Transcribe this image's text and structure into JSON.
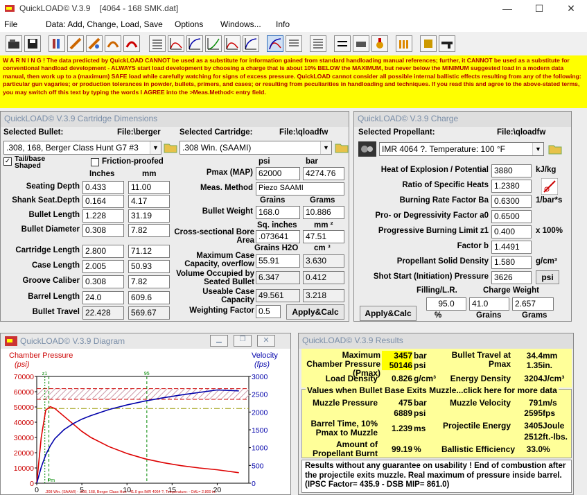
{
  "window": {
    "title": "QuickLOAD© V.3.9    [4064 - 168 SMK.dat]",
    "minimize": "—",
    "maximize": "☐",
    "close": "✕"
  },
  "menu": {
    "file": "File",
    "data": "Data: Add, Change, Load, Save",
    "options": "Options",
    "windows": "Windows...",
    "info": "Info"
  },
  "warning": "W A R N I N G ! The data predicted by QuickLOAD CANNOT be used as a substitute for information gained from standard handloading manual references; further, it CANNOT be used as a substitute for conventional handload development - ALWAYS start load development by choosing a charge that is about 10% BELOW the MAXIMUM, but never below the MINIMUM suggested load in a modern data manual, then work up to a (maximum) SAFE load while carefully watching for signs of excess pressure. QuickLOAD cannot consider all possible internal ballistic effects resulting from any of the following: particular gun vagaries; or production tolerances in powder, bullets, primers, and cases; or resulting from peculiarities in handloading and techniques. If you read this and agree to the above-stated terms, you may switch off this text by typing the words I AGREE into the >Meas.Method< entry field.",
  "cart": {
    "title": "QuickLOAD© V.3.9 Cartridge Dimensions",
    "selected_bullet_label": "Selected Bullet:",
    "bullet_file": "File:\\berger",
    "bullet": ".308, 168, Berger Class Hunt G7 #3",
    "selected_cart_label": "Selected Cartridge:",
    "cart_file": "File:\\qloadfw",
    "cartridge": ".308 Win. (SAAMI)",
    "tail_base": "Tail/base Shaped",
    "friction": "Friction-proofed",
    "inches": "Inches",
    "mm": "mm",
    "rows": [
      {
        "label": "Seating Depth",
        "in": "0.433",
        "mm": "11.00"
      },
      {
        "label": "Shank Seat.Depth",
        "in": "0.164",
        "mm": "4.17"
      },
      {
        "label": "Bullet Length",
        "in": "1.228",
        "mm": "31.19"
      },
      {
        "label": "Bullet Diameter",
        "in": "0.308",
        "mm": "7.82"
      },
      {
        "label": "Cartridge Length",
        "in": "2.800",
        "mm": "71.12"
      },
      {
        "label": "Case Length",
        "in": "2.005",
        "mm": "50.93"
      },
      {
        "label": "Groove Caliber",
        "in": "0.308",
        "mm": "7.82"
      },
      {
        "label": "Barrel Length",
        "in": "24.0",
        "mm": "609.6"
      },
      {
        "label": "Bullet Travel",
        "in": "22.428",
        "mm": "569.67"
      }
    ],
    "psi": "psi",
    "bar": "bar",
    "pmax_label": "Pmax (MAP)",
    "pmax_psi": "62000",
    "pmax_bar": "4274.76",
    "meas_label": "Meas. Method",
    "meas": "Piezo SAAMI",
    "grains": "Grains",
    "grams": "Grams",
    "bw_label": "Bullet Weight",
    "bw_gr": "168.0",
    "bw_g": "10.886",
    "sq_in": "Sq. inches",
    "mm2": "mm ²",
    "csba_label": "Cross-sectional Bore Area",
    "csba_in": ".073641",
    "csba_mm": "47.51",
    "grains_h2o": "Grains H2O",
    "cm3": "cm ³",
    "mcc_label": "Maximum Case Capacity, overflow",
    "mcc_gr": "55.91",
    "mcc_cm": "3.630",
    "vol_label": "Volume Occupied by Seated Bullet",
    "vol_gr": "6.347",
    "vol_cm": "0.412",
    "ucc_label": "Useable Case Capacity",
    "ucc_gr": "49.561",
    "ucc_cm": "3.218",
    "wf_label": "Weighting Factor",
    "wf": "0.5",
    "apply": "Apply&Calc"
  },
  "charge": {
    "title": "QuickLOAD© V.3.9 Charge",
    "selected_label": "Selected Propellant:",
    "file": "File:\\qloadfw",
    "propellant": "IMR 4064 ?.  Temperature: 100 °F",
    "rows": [
      {
        "label": "Heat of Explosion / Potential",
        "value": "3880",
        "unit": "kJ/kg"
      },
      {
        "label": "Ratio of Specific Heats",
        "value": "1.2380",
        "unit": ""
      },
      {
        "label": "Burning Rate Factor  Ba",
        "value": "0.6300",
        "unit": "1/bar*s"
      },
      {
        "label": "Pro- or Degressivity Factor  a0",
        "value": "0.6500",
        "unit": ""
      },
      {
        "label": "Progressive Burning Limit z1",
        "value": "0.400",
        "unit": "x 100%"
      },
      {
        "label": "Factor  b",
        "value": "1.4491",
        "unit": ""
      },
      {
        "label": "Propellant Solid Density",
        "value": "1.580",
        "unit": "g/cm³"
      },
      {
        "label": "Shot Start (Initiation) Pressure",
        "value": "3626",
        "unit": "psi"
      }
    ],
    "filling_label": "Filling/L.R.",
    "charge_weight": "Charge Weight",
    "filling": "95.0",
    "cw_gr": "41.0",
    "cw_g": "2.657",
    "pct": "%",
    "grains": "Grains",
    "grams": "Grams",
    "apply": "Apply&Calc"
  },
  "diagram": {
    "title": "QuickLOAD© V.3.9 Diagram",
    "left_axis_title": "Chamber Pressure",
    "left_unit": "(psi)",
    "right_axis_title": "Velocity",
    "right_unit": "(fps)",
    "xlabel": "Projectile travel (in.)",
    "y_ticks": [
      "70000",
      "60000",
      "50000",
      "40000",
      "30000",
      "20000",
      "10000",
      "0"
    ],
    "v_ticks": [
      "3000",
      "2500",
      "2000",
      "1500",
      "1000",
      "500",
      "0"
    ],
    "x_ticks": [
      "0",
      "5",
      "10",
      "15",
      "20"
    ],
    "mark_z1": "z1",
    "mark_95": "95",
    "mark_pm": "Pm",
    "footer": ".308 Win. (SAAMI) - .308, 168, Berger Class Hun - 41.0 grs IMR 4064 ?, Temperature: - OAL= 2.800 in."
  },
  "chart_data": {
    "type": "line",
    "xlabel": "Projectile travel (in.)",
    "ylabel": "Chamber Pressure (psi)",
    "y2label": "Velocity (fps)",
    "xlim": [
      0,
      23.5
    ],
    "ylim": [
      0,
      70000
    ],
    "y2lim": [
      0,
      3000
    ],
    "series": [
      {
        "axis": "left",
        "x": [
          0,
          0.5,
          1,
          1.5,
          2,
          3,
          4,
          5,
          6,
          8,
          10,
          12,
          14,
          16,
          18,
          20,
          22.4
        ],
        "values": [
          0,
          30000,
          48000,
          50146,
          49000,
          44000,
          39000,
          34000,
          30000,
          24000,
          19500,
          16000,
          13500,
          11500,
          10000,
          8800,
          6889
        ]
      },
      {
        "axis": "right",
        "x": [
          0,
          0.5,
          1,
          1.5,
          2,
          3,
          4,
          5,
          6,
          8,
          10,
          12,
          14,
          16,
          18,
          20,
          22.4
        ],
        "values": [
          0,
          450,
          800,
          1050,
          1250,
          1500,
          1670,
          1800,
          1900,
          2070,
          2200,
          2310,
          2400,
          2480,
          2550,
          2620,
          2595
        ]
      }
    ]
  },
  "results": {
    "title": "QuickLOAD© V.3.9 Results",
    "mcp_label": "Maximum Chamber Pressure (Pmax)",
    "mcp_bar": "3457",
    "bar": "bar",
    "mcp_psi": "50146",
    "psi": "psi",
    "btp_label": "Bullet Travel at Pmax",
    "btp_mm": "34.4",
    "mm": "mm",
    "btp_in": "1.35",
    "in": "in.",
    "ld_label": "Load Density",
    "ld": "0.826",
    "gcm3": "g/cm³",
    "en_label": "Energy Density",
    "en": "3204",
    "jcm3": "J/cm³",
    "exit_header": "Values when Bullet Base Exits Muzzle...click here for more data",
    "mp_label": "Muzzle Pressure",
    "mp_bar": "475",
    "mp_psi": "6889",
    "mv_label": "Muzzle Velocity",
    "mv_ms": "791",
    "ms": "m/s",
    "mv_fps": "2595",
    "fps": "fps",
    "bt_label": "Barrel Time, 10% Pmax to Muzzle",
    "bt": "1.239",
    "ms_unit": "ms",
    "pe_label": "Projectile Energy",
    "pe_j": "3405",
    "joule": "Joule",
    "pe_ft": "2512",
    "ftlbs": "ft.-lbs.",
    "apb_label": "Amount of Propellant Burnt",
    "apb": "99.19",
    "pct": "%",
    "be_label": "Ballistic Efficiency",
    "be": "33.0",
    "note": "Results without any guarantee on usability !  End of combustion after the projectile exits muzzle.  Real maximum of pressure inside barrel.  (IPSC Factor= 435.9 - DSB MIP= 861.0)"
  }
}
